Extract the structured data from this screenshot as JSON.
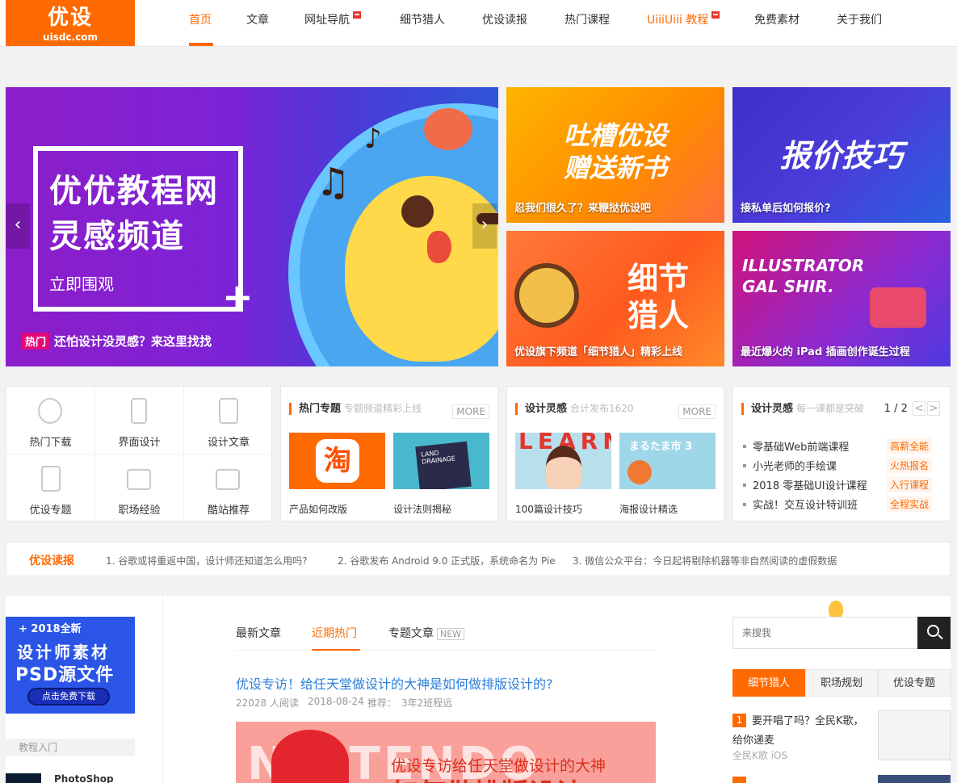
{
  "brand": {
    "logo_cn": "优设",
    "logo_url": "uisdc.com",
    "accent": "#ff6a00"
  },
  "nav": [
    {
      "label": "首页",
      "active": true
    },
    {
      "label": "文章"
    },
    {
      "label": "网址导航",
      "hot": true
    },
    {
      "label": "细节猎人"
    },
    {
      "label": "优设读报"
    },
    {
      "label": "热门课程"
    },
    {
      "label": "UiiiUiii 教程",
      "hot": true,
      "orange": true
    },
    {
      "label": "免费素材"
    },
    {
      "label": "关于我们"
    }
  ],
  "banner": {
    "line1": "优优教程网",
    "line2": "灵感频道",
    "cta": "立即围观",
    "tag": "热门",
    "caption": "还怕设计没灵感？来这里找找",
    "prev": "‹",
    "next": "›"
  },
  "mini_banners": [
    {
      "caption": "忍我们很久了？来鞭挞优设吧",
      "big": "吐槽优设\n赠送新书"
    },
    {
      "caption": "接私单后如何报价?",
      "big": "报价技巧"
    },
    {
      "caption": "优设旗下频道「细节猎人」精彩上线",
      "big": "细节猎人"
    },
    {
      "caption": "最近爆火的 iPad 插画创作诞生过程",
      "big": "ILLUSTRATOR\nGAL SHIR."
    }
  ],
  "quick_links": [
    "热门下载",
    "界面设计",
    "设计文章",
    "优设专题",
    "职场经验",
    "酷站推荐"
  ],
  "hot_topics": {
    "title": "热门专题",
    "subtitle": "专题频道精彩上线",
    "more": "MORE",
    "items": [
      {
        "label": "产品如何改版",
        "thumb_text": "淘"
      },
      {
        "label": "设计法则揭秘",
        "thumb_text": "LAND DRAINAGE"
      }
    ]
  },
  "inspiration": {
    "title": "设计灵感",
    "subtitle": "合计发布1620",
    "more": "MORE",
    "items": [
      {
        "label": "100篇设计技巧",
        "thumb_text": "LEARN"
      },
      {
        "label": "海报设计精选",
        "thumb_text": "まるたま市 3"
      }
    ]
  },
  "courses": {
    "title": "设计灵感",
    "subtitle": "每一课都是突破",
    "pager": "1 / 2",
    "prev": "<",
    "next": ">",
    "items": [
      {
        "name": "零基础Web前端课程",
        "badge": "高薪全能"
      },
      {
        "name": "小光老师的手绘课",
        "badge": "火热报名"
      },
      {
        "name": "2018 零基础UI设计课程",
        "badge": "入行课程"
      },
      {
        "name": "实战！交互设计特训班",
        "badge": "全程实战"
      }
    ]
  },
  "news": {
    "title": "优设读报",
    "items": [
      "1. 谷歌或将重返中国，设计师还知道怎么用吗?",
      "2. 谷歌发布 Android 9.0 正式版，系统命名为 Pie",
      "3. 微信公众平台：今日起将剔除机器等非自然阅读的虚假数据"
    ]
  },
  "ad": {
    "line1": "+ 2018全新",
    "line2": "设计师素材",
    "line3": "PSD源文件",
    "button": "点击免费下载"
  },
  "tutorial": {
    "label": "教程入门",
    "item": "PhotoShop"
  },
  "tabs": {
    "latest": "最新文章",
    "hot": "近期热门",
    "topic": "专题文章",
    "new_badge": "NEW"
  },
  "article": {
    "title": "优设专访！给任天堂做设计的大神是如何做排版设计的?",
    "reads": "22028 人阅读",
    "date": "2018-08-24",
    "recommender_label": "推荐：",
    "recommender": "3年2班程远",
    "img_line1": "优设专访给任天堂做设计的大神",
    "img_line2": "如何做排版设计",
    "img_nin": "NINTENDO"
  },
  "search": {
    "placeholder": "来搜我"
  },
  "side_tabs": [
    "细节猎人",
    "职场规划",
    "优设专题"
  ],
  "rank": {
    "num1": "1",
    "title1a": "要开唱了吗？全民K歌，",
    "title1b": "给你递麦",
    "sub1": "全民K歌 iOS"
  }
}
